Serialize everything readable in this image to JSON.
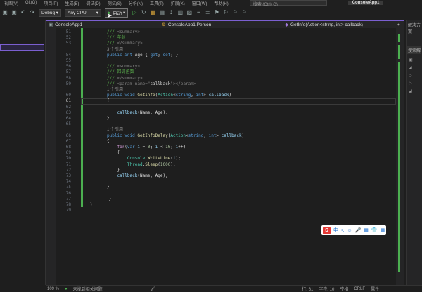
{
  "menu": {
    "items": [
      "视图(V)",
      "Git(G)",
      "项目(P)",
      "生成(B)",
      "调试(D)",
      "测试(S)",
      "分析(N)",
      "工具(T)",
      "扩展(X)",
      "窗口(W)",
      "帮助(H)"
    ],
    "search_placeholder": "搜索 (Ctrl+Q)",
    "project": "ConsoleApp1"
  },
  "toolbar": {
    "config": "Debug",
    "platform": "Any CPU",
    "run_label": "启动"
  },
  "navbar": {
    "project": "ConsoleApp1",
    "class": "ConsoleApp1.Person",
    "member": "GetInfo(Action<string, int> callback)"
  },
  "right_panel": {
    "title": "解决方案",
    "search": "搜索解"
  },
  "lines": [
    {
      "n": "51",
      "segs": [
        [
          "cm",
          "/// "
        ],
        [
          "xml",
          "<summary>"
        ]
      ]
    },
    {
      "n": "52",
      "segs": [
        [
          "cm",
          "/// 年龄"
        ]
      ]
    },
    {
      "n": "53",
      "segs": [
        [
          "cm",
          "/// "
        ],
        [
          "xml",
          "</summary>"
        ]
      ]
    },
    {
      "lens": "3 个引用"
    },
    {
      "n": "54",
      "segs": [
        [
          "kw",
          "public int "
        ],
        [
          "tx",
          "Age { "
        ],
        [
          "kw",
          "get"
        ],
        [
          "tx",
          "; "
        ],
        [
          "kw",
          "set"
        ],
        [
          "tx",
          "; }"
        ]
      ]
    },
    {
      "n": "55",
      "segs": []
    },
    {
      "n": "56",
      "segs": [
        [
          "cm",
          "/// "
        ],
        [
          "xml",
          "<summary>"
        ]
      ]
    },
    {
      "n": "57",
      "segs": [
        [
          "cm",
          "/// 回调函数"
        ]
      ]
    },
    {
      "n": "58",
      "segs": [
        [
          "cm",
          "/// "
        ],
        [
          "xml",
          "</summary>"
        ]
      ]
    },
    {
      "n": "59",
      "segs": [
        [
          "cm",
          "/// "
        ],
        [
          "xml",
          "<param name=\""
        ],
        [
          "tx",
          "callback"
        ],
        [
          "xml",
          "\"></param>"
        ]
      ]
    },
    {
      "lens": "1 个引用"
    },
    {
      "n": "60",
      "segs": [
        [
          "kw",
          "public void "
        ],
        [
          "fn",
          "GetInfo"
        ],
        [
          "tx",
          "("
        ],
        [
          "ty",
          "Action"
        ],
        [
          "tx",
          "<"
        ],
        [
          "kw",
          "string"
        ],
        [
          "tx",
          ", "
        ],
        [
          "kw",
          "int"
        ],
        [
          "tx",
          "> "
        ],
        [
          "pm",
          "callback"
        ],
        [
          "tx",
          ")"
        ]
      ]
    },
    {
      "n": "61",
      "cur": true,
      "segs": [
        [
          "tx",
          "{"
        ]
      ]
    },
    {
      "n": "62",
      "segs": []
    },
    {
      "n": "63",
      "segs": [
        [
          "tx",
          "    "
        ],
        [
          "pm",
          "callback"
        ],
        [
          "tx",
          "(Name, Age);"
        ]
      ]
    },
    {
      "n": "64",
      "segs": [
        [
          "tx",
          "}"
        ]
      ]
    },
    {
      "n": "65",
      "segs": []
    },
    {
      "lens": "1 个引用"
    },
    {
      "n": "66",
      "segs": [
        [
          "kw",
          "public void "
        ],
        [
          "fn",
          "GetInfoDelay"
        ],
        [
          "tx",
          "("
        ],
        [
          "ty",
          "Action"
        ],
        [
          "tx",
          "<"
        ],
        [
          "kw",
          "string"
        ],
        [
          "tx",
          ", "
        ],
        [
          "kw",
          "int"
        ],
        [
          "tx",
          "> "
        ],
        [
          "pm",
          "callback"
        ],
        [
          "tx",
          ")"
        ]
      ]
    },
    {
      "n": "67",
      "segs": [
        [
          "tx",
          "{"
        ]
      ]
    },
    {
      "n": "68",
      "segs": [
        [
          "tx",
          "    "
        ],
        [
          "ctl",
          "for"
        ],
        [
          "tx",
          "("
        ],
        [
          "kw",
          "var "
        ],
        [
          "pm",
          "i"
        ],
        [
          "tx",
          " = "
        ],
        [
          "num",
          "0"
        ],
        [
          "tx",
          "; "
        ],
        [
          "pm",
          "i"
        ],
        [
          "tx",
          " < "
        ],
        [
          "num",
          "10"
        ],
        [
          "tx",
          "; "
        ],
        [
          "pm",
          "i"
        ],
        [
          "tx",
          "++)"
        ]
      ]
    },
    {
      "n": "69",
      "segs": [
        [
          "tx",
          "    {"
        ]
      ]
    },
    {
      "n": "70",
      "segs": [
        [
          "tx",
          "        "
        ],
        [
          "ty",
          "Console"
        ],
        [
          "tx",
          "."
        ],
        [
          "fn",
          "WriteLine"
        ],
        [
          "tx",
          "("
        ],
        [
          "pm",
          "i"
        ],
        [
          "tx",
          ");"
        ]
      ]
    },
    {
      "n": "71",
      "segs": [
        [
          "tx",
          "        "
        ],
        [
          "ty",
          "Thread"
        ],
        [
          "tx",
          "."
        ],
        [
          "fn",
          "Sleep"
        ],
        [
          "tx",
          "("
        ],
        [
          "num",
          "1000"
        ],
        [
          "tx",
          ");"
        ]
      ]
    },
    {
      "n": "72",
      "segs": [
        [
          "tx",
          "    }"
        ]
      ]
    },
    {
      "n": "73",
      "segs": [
        [
          "tx",
          "    "
        ],
        [
          "pm",
          "callback"
        ],
        [
          "tx",
          "(Name, Age);"
        ]
      ]
    },
    {
      "n": "74",
      "segs": []
    },
    {
      "n": "75",
      "segs": [
        [
          "tx",
          "}"
        ]
      ]
    },
    {
      "n": "76",
      "segs": []
    },
    {
      "n": "77",
      "segs": [
        [
          "tx",
          "    }"
        ]
      ],
      "indent": -2
    },
    {
      "n": "78",
      "segs": [
        [
          "tx",
          "}"
        ]
      ],
      "indent": -4
    },
    {
      "n": "79",
      "segs": []
    }
  ],
  "ime": {
    "items": [
      "中",
      "•,",
      "☺",
      "🎤",
      "▦",
      "👕",
      "▦"
    ]
  },
  "status": {
    "zoom": "109 %",
    "issues": "未找到相关问题",
    "line": "行: 61",
    "col": "字符: 10",
    "mode": "空格",
    "eol": "CRLF",
    "right": "属性"
  }
}
